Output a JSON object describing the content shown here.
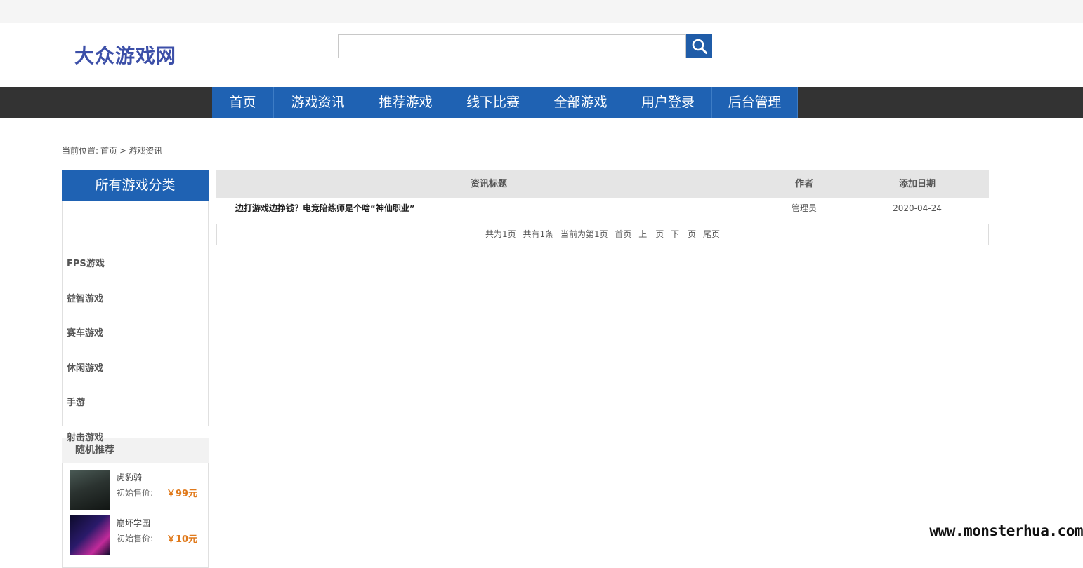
{
  "header": {
    "logo_text": "大众游戏网",
    "search": {
      "value": "",
      "placeholder": ""
    }
  },
  "nav": {
    "items": [
      {
        "label": "首页"
      },
      {
        "label": "游戏资讯"
      },
      {
        "label": "推荐游戏"
      },
      {
        "label": "线下比赛"
      },
      {
        "label": "全部游戏"
      },
      {
        "label": "用户登录"
      },
      {
        "label": "后台管理"
      }
    ]
  },
  "breadcrumb": {
    "prefix": "当前位置:",
    "home": "首页",
    "separator": ">",
    "current": "游戏资讯"
  },
  "sidebar": {
    "categories_title": "所有游戏分类",
    "categories": [
      "FPS游戏",
      "益智游戏",
      "赛车游戏",
      "休闲游戏",
      "手游",
      "射击游戏"
    ],
    "recommend_title": "随机推荐",
    "recommend": [
      {
        "name": "虎豹骑",
        "price_label": "初始售价:",
        "price": "￥99元"
      },
      {
        "name": "崩坏学园",
        "price_label": "初始售价:",
        "price": "￥10元"
      }
    ]
  },
  "news_table": {
    "headers": {
      "title": "资讯标题",
      "author": "作者",
      "date": "添加日期"
    },
    "rows": [
      {
        "title": "边打游戏边挣钱？电竞陪练师是个啥“神仙职业”",
        "author": "管理员",
        "date": "2020-04-24"
      }
    ]
  },
  "pager": {
    "total_pages": "共为1页",
    "total_items": "共有1条",
    "current_page": "当前为第1页",
    "first": "首页",
    "prev": "上一页",
    "next": "下一页",
    "last": "尾页"
  },
  "watermark": "www.monsterhua.com",
  "colors": {
    "nav_blue": "#1f62b3",
    "nav_bar": "#333333",
    "logo": "#3c4fa8",
    "price": "#e07a1c"
  }
}
